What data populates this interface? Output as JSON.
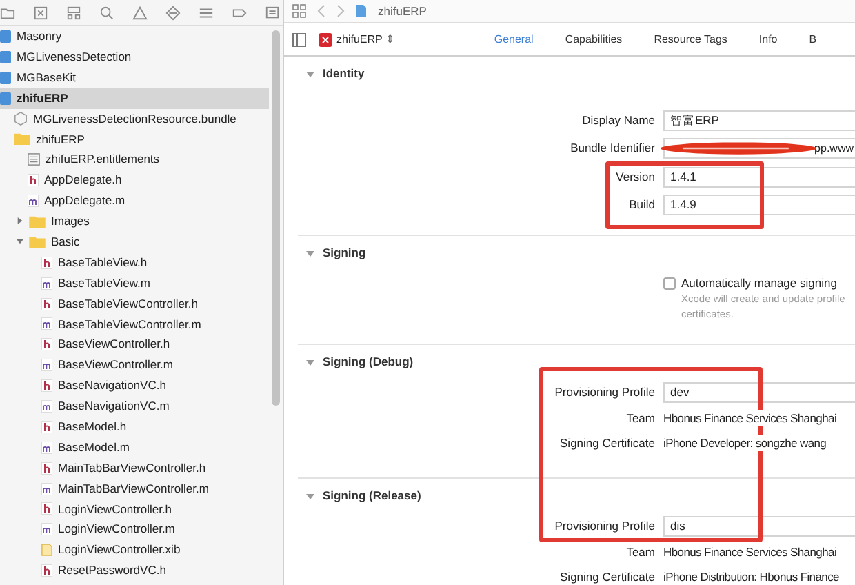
{
  "tree": [
    {
      "name": "Masonry",
      "kind": "project",
      "selected": false
    },
    {
      "name": "MGLivenessDetection",
      "kind": "project",
      "selected": false
    },
    {
      "name": "MGBaseKit",
      "kind": "project",
      "selected": false
    },
    {
      "name": "zhifuERP",
      "kind": "project",
      "selected": true,
      "children": [
        {
          "name": "MGLivenessDetectionResource.bundle",
          "kind": "bundle",
          "selected": false
        },
        {
          "name": "zhifuERP",
          "kind": "folder",
          "selected": false,
          "children": [
            {
              "name": "zhifuERP.entitlements",
              "kind": "entitlements",
              "selected": false
            },
            {
              "name": "AppDelegate.h",
              "kind": "h",
              "selected": false
            },
            {
              "name": "AppDelegate.m",
              "kind": "m",
              "selected": false
            },
            {
              "name": "Images",
              "kind": "folder",
              "selected": false,
              "expanded": false
            },
            {
              "name": "Basic",
              "kind": "folder",
              "selected": false,
              "expanded": true,
              "children": [
                {
                  "name": "BaseTableView.h",
                  "kind": "h",
                  "selected": false
                },
                {
                  "name": "BaseTableView.m",
                  "kind": "m",
                  "selected": false
                },
                {
                  "name": "BaseTableViewController.h",
                  "kind": "h",
                  "selected": false
                },
                {
                  "name": "BaseTableViewController.m",
                  "kind": "m",
                  "selected": false
                },
                {
                  "name": "BaseViewController.h",
                  "kind": "h",
                  "selected": false
                },
                {
                  "name": "BaseViewController.m",
                  "kind": "m",
                  "selected": false
                },
                {
                  "name": "BaseNavigationVC.h",
                  "kind": "h",
                  "selected": false
                },
                {
                  "name": "BaseNavigationVC.m",
                  "kind": "m",
                  "selected": false
                },
                {
                  "name": "BaseModel.h",
                  "kind": "h",
                  "selected": false
                },
                {
                  "name": "BaseModel.m",
                  "kind": "m",
                  "selected": false
                },
                {
                  "name": "MainTabBarViewController.h",
                  "kind": "h",
                  "selected": false
                },
                {
                  "name": "MainTabBarViewController.m",
                  "kind": "m",
                  "selected": false
                },
                {
                  "name": "LoginViewController.h",
                  "kind": "h",
                  "selected": false
                },
                {
                  "name": "LoginViewController.m",
                  "kind": "m",
                  "selected": false
                },
                {
                  "name": "LoginViewController.xib",
                  "kind": "xib",
                  "selected": false
                },
                {
                  "name": "ResetPasswordVC.h",
                  "kind": "h",
                  "selected": false
                }
              ]
            }
          ]
        }
      ]
    }
  ],
  "breadcrumb": {
    "file": "zhifuERP"
  },
  "target": {
    "name": "zhifuERP",
    "stepper": "⇕"
  },
  "tabs": [
    {
      "label": "General",
      "selected": true
    },
    {
      "label": "Capabilities",
      "selected": false
    },
    {
      "label": "Resource Tags",
      "selected": false
    },
    {
      "label": "Info",
      "selected": false
    },
    {
      "label": "B",
      "selected": false
    }
  ],
  "sections": [
    {
      "title": "Identity",
      "expanded": true,
      "rows": [
        {
          "kind": "field",
          "label": "Display Name",
          "value": "智富ERP"
        },
        {
          "kind": "redacted",
          "label": "Bundle Identifier",
          "value": "pp.www"
        },
        {
          "kind": "field",
          "label": "Version",
          "value": "1.4.1"
        },
        {
          "kind": "field",
          "label": "Build",
          "value": "1.4.9"
        }
      ]
    },
    {
      "title": "Signing",
      "expanded": true,
      "rows": [
        {
          "kind": "checkbox",
          "label": "Automatically manage signing",
          "checked": false,
          "note": [
            "Xcode will create and update profile",
            "certificates."
          ]
        }
      ]
    },
    {
      "title": "Signing (Debug)",
      "expanded": true,
      "rows": [
        {
          "kind": "field",
          "label": "Provisioning Profile",
          "value": "dev"
        },
        {
          "kind": "text",
          "label": "Team",
          "value": "Hbonus Finance Services Shanghai"
        },
        {
          "kind": "text",
          "label": "Signing Certificate",
          "value": "iPhone Developer: songzhe wang"
        }
      ]
    },
    {
      "title": "Signing (Release)",
      "expanded": true,
      "rows": [
        {
          "kind": "field",
          "label": "Provisioning Profile",
          "value": "dis"
        },
        {
          "kind": "text",
          "label": "Team",
          "value": "Hbonus Finance Services Shanghai"
        },
        {
          "kind": "text",
          "label": "Signing Certificate",
          "value": "iPhone Distribution: Hbonus Finance"
        }
      ]
    }
  ]
}
